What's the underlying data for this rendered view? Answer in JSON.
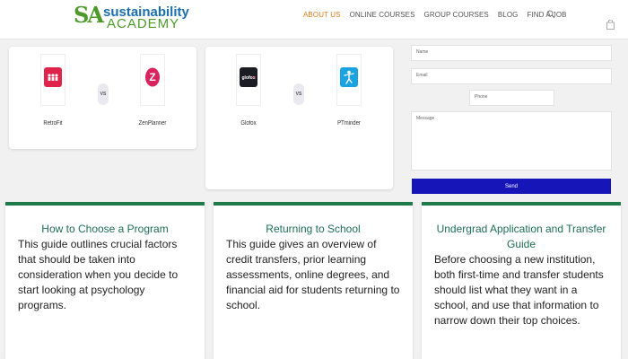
{
  "header": {
    "logo": {
      "mark": "SA",
      "line1": "sustainability",
      "line2": "ACADEMY"
    },
    "nav": [
      {
        "label": "ABOUT US",
        "active": true
      },
      {
        "label": "ONLINE COURSES"
      },
      {
        "label": "GROUP COURSES"
      },
      {
        "label": "BLOG"
      },
      {
        "label": "FIND A JOB"
      }
    ],
    "icons": {
      "search": "search-icon",
      "cart": "shopping-bag-icon"
    }
  },
  "comparisons": [
    {
      "left": {
        "name": "RetroFit",
        "color": "#e0234a"
      },
      "vs": "VS",
      "right": {
        "name": "ZenPlanner",
        "color": "#d8235c"
      }
    },
    {
      "left": {
        "name": "Glofox",
        "color": "#1c1c24"
      },
      "vs": "VS",
      "right": {
        "name": "PTminder",
        "color": "#1aa3e0"
      }
    }
  ],
  "form": {
    "name_placeholder": "Name",
    "email_placeholder": "Email",
    "phone_placeholder": "Phone",
    "message_placeholder": "Message",
    "send_label": "Send"
  },
  "guides": [
    {
      "title": "How to Choose a Program",
      "body": "This guide outlines crucial factors that should be taken into consideration when you decide to start looking at psychology programs."
    },
    {
      "title": "Returning to School",
      "body": "This guide gives an overview of credit transfers, prior learning assessments, online degrees, and financial aid for students returning to school."
    },
    {
      "title": "Undergrad Application and Transfer Guide",
      "body": "Before choosing a new institution, both first-time and transfer students should list what they want in a school, and use that information to narrow down their top choices."
    }
  ],
  "colors": {
    "accent_nav": "#e07d1c",
    "send_button": "#1616b8",
    "guide_border": "#1f7a4a",
    "guide_title": "#1f6e52"
  }
}
